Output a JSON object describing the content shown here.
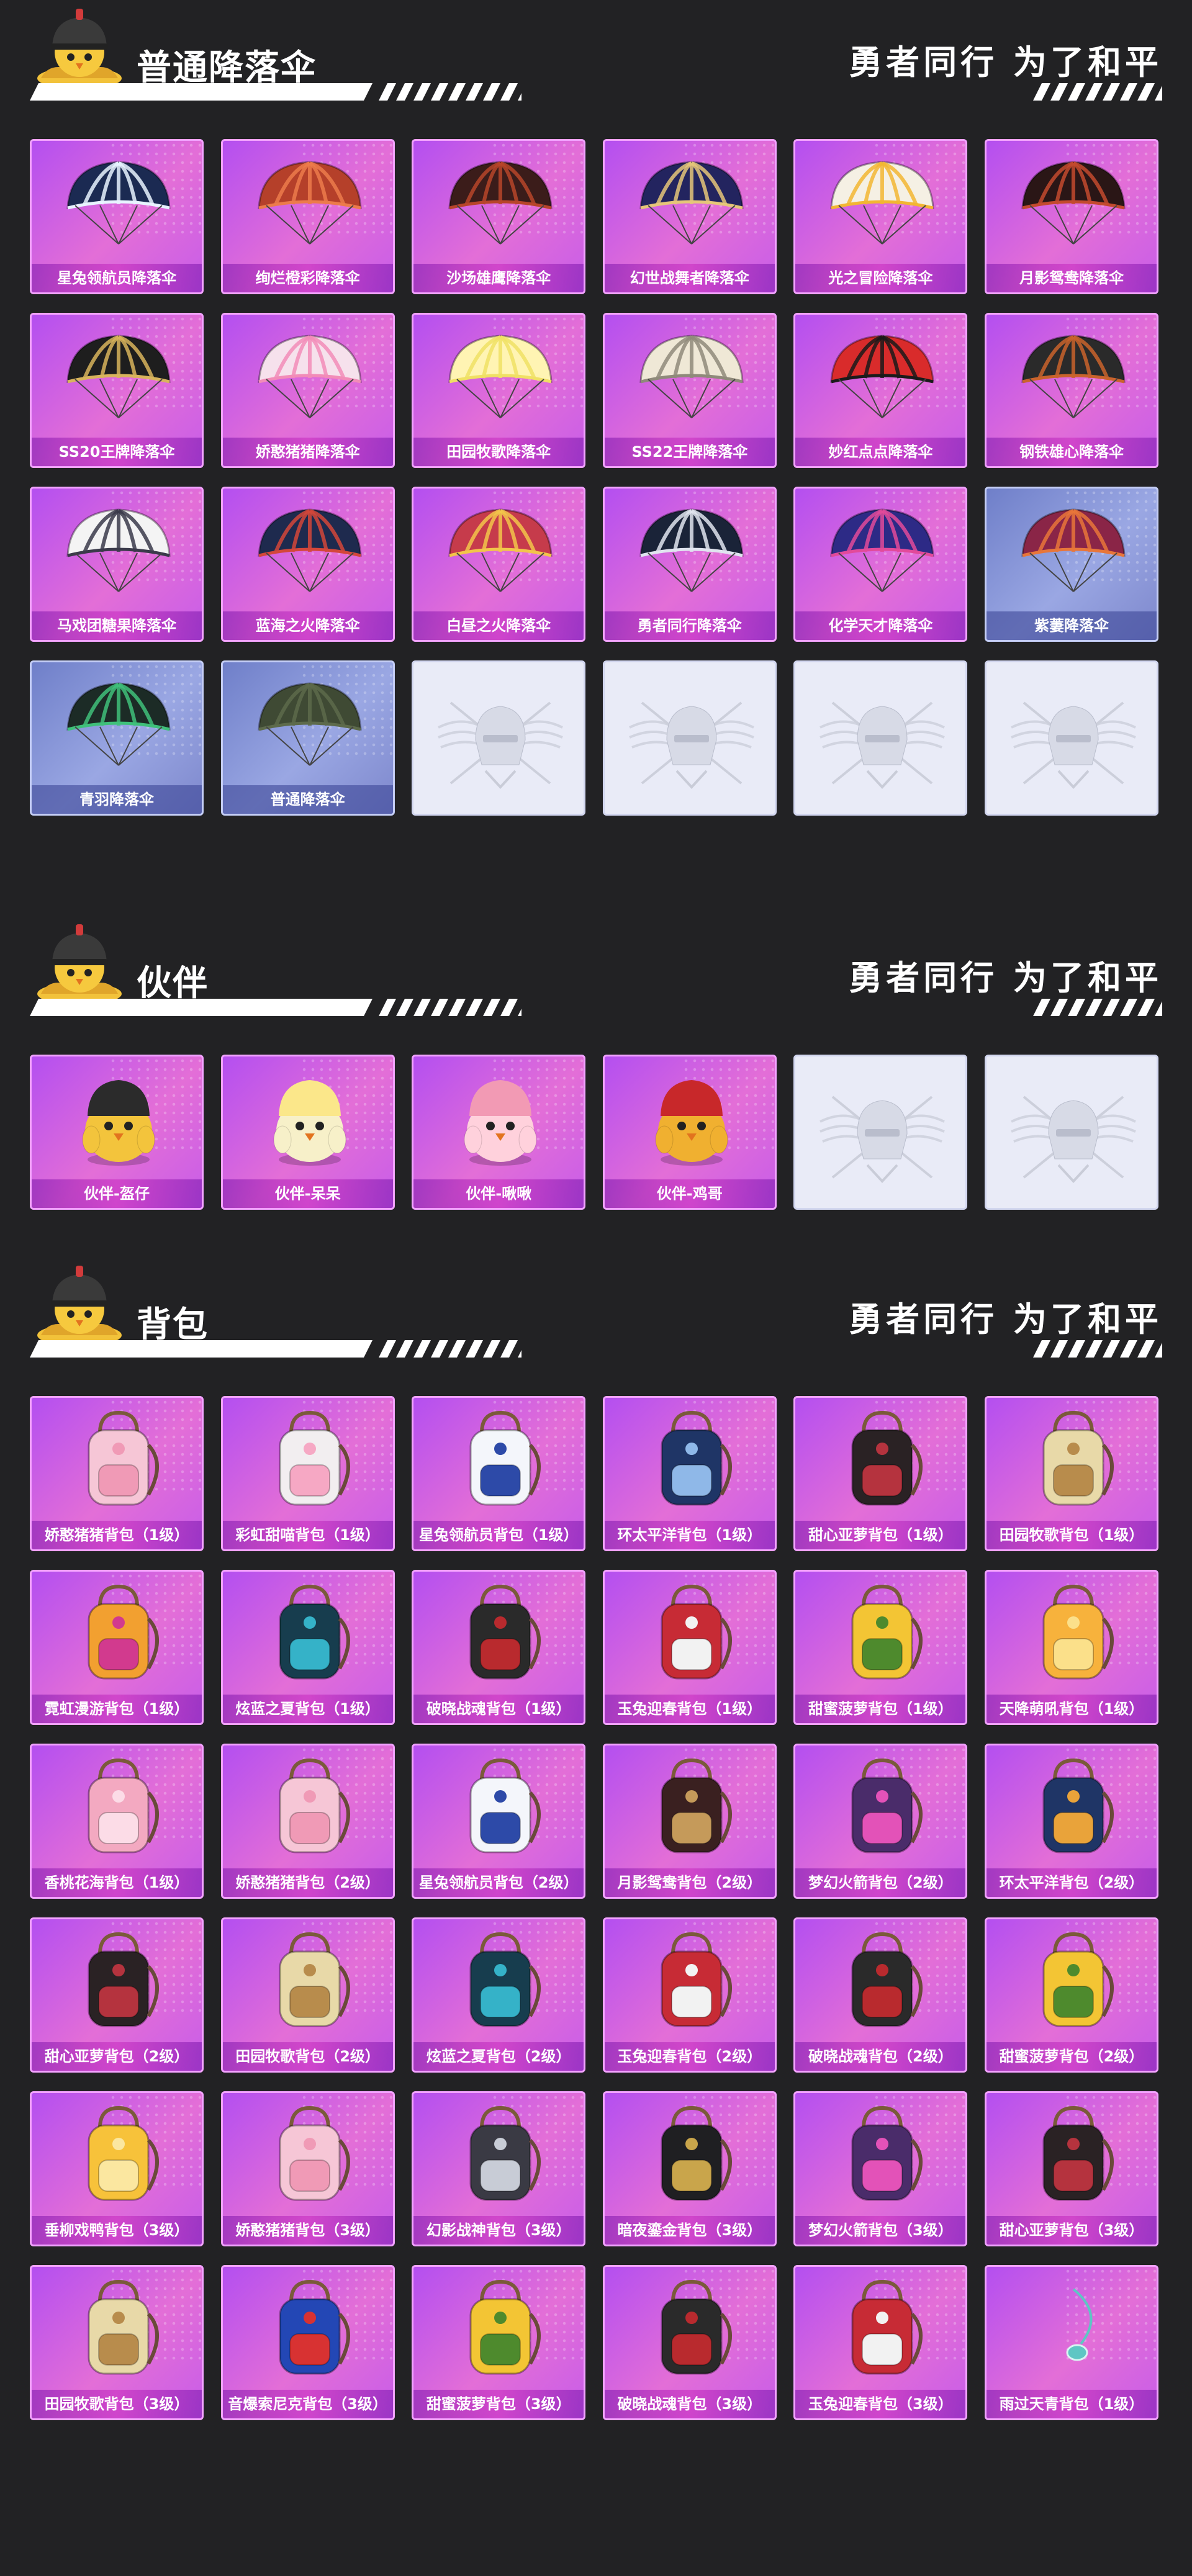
{
  "sections": [
    {
      "title": "普通降落伞",
      "slogan": "勇者同行 为了和平",
      "items": [
        {
          "label": "星兔领航员降落伞",
          "style": "purple",
          "icon": "parachute-icon",
          "colors": [
            "#1b2a52",
            "#e8f3ff"
          ]
        },
        {
          "label": "绚烂橙彩降落伞",
          "style": "purple",
          "icon": "parachute-icon",
          "colors": [
            "#b5402a",
            "#ec7b4b"
          ]
        },
        {
          "label": "沙场雄鹰降落伞",
          "style": "purple",
          "icon": "parachute-icon",
          "colors": [
            "#3b1c1a",
            "#b7452a"
          ]
        },
        {
          "label": "幻世战舞者降落伞",
          "style": "purple",
          "icon": "parachute-icon",
          "colors": [
            "#23245f",
            "#e5c679"
          ]
        },
        {
          "label": "光之冒险降落伞",
          "style": "purple",
          "icon": "parachute-icon",
          "colors": [
            "#f5f0e4",
            "#f2b632"
          ]
        },
        {
          "label": "月影鸳鸯降落伞",
          "style": "purple",
          "icon": "parachute-icon",
          "colors": [
            "#2a1616",
            "#c34a2e"
          ]
        },
        {
          "label": "SS20王牌降落伞",
          "style": "purple",
          "icon": "parachute-icon",
          "colors": [
            "#1e1e1e",
            "#d8b45c"
          ]
        },
        {
          "label": "娇憨猪猪降落伞",
          "style": "purple",
          "icon": "parachute-icon",
          "colors": [
            "#f6e1ec",
            "#f28cb8"
          ]
        },
        {
          "label": "田园牧歌降落伞",
          "style": "purple",
          "icon": "parachute-icon",
          "colors": [
            "#fff4b3",
            "#f0e064"
          ]
        },
        {
          "label": "SS22王牌降落伞",
          "style": "purple",
          "icon": "parachute-icon",
          "colors": [
            "#efe8d6",
            "#8f8a7a"
          ]
        },
        {
          "label": "妙红点点降落伞",
          "style": "purple",
          "icon": "parachute-icon",
          "colors": [
            "#d92b2b",
            "#1a1a1a"
          ]
        },
        {
          "label": "钢铁雄心降落伞",
          "style": "purple",
          "icon": "parachute-icon",
          "colors": [
            "#2a2a2a",
            "#c9632c"
          ]
        },
        {
          "label": "马戏团糖果降落伞",
          "style": "purple",
          "icon": "parachute-icon",
          "colors": [
            "#f4f4f4",
            "#3a3a4a"
          ]
        },
        {
          "label": "蓝海之火降落伞",
          "style": "purple",
          "icon": "parachute-icon",
          "colors": [
            "#1e2a4e",
            "#d3473a"
          ]
        },
        {
          "label": "白昼之火降落伞",
          "style": "purple",
          "icon": "parachute-icon",
          "colors": [
            "#c63b4b",
            "#f2c54a"
          ]
        },
        {
          "label": "勇者同行降落伞",
          "style": "purple",
          "icon": "parachute-icon",
          "colors": [
            "#1a2338",
            "#e0e4ef"
          ]
        },
        {
          "label": "化学天才降落伞",
          "style": "purple",
          "icon": "parachute-icon",
          "colors": [
            "#2d2a86",
            "#e24a9a"
          ]
        },
        {
          "label": "紫萋降落伞",
          "style": "blue",
          "icon": "parachute-icon",
          "colors": [
            "#8a2547",
            "#e8763a"
          ]
        },
        {
          "label": "青羽降落伞",
          "style": "blue",
          "icon": "parachute-icon",
          "colors": [
            "#1c2b26",
            "#3fc07a"
          ]
        },
        {
          "label": "普通降落伞",
          "style": "blue",
          "icon": "parachute-icon",
          "colors": [
            "#3f4a34",
            "#5d6a4b"
          ]
        },
        {
          "label": "",
          "style": "empty",
          "icon": "emblem-placeholder-icon"
        },
        {
          "label": "",
          "style": "empty",
          "icon": "emblem-placeholder-icon"
        },
        {
          "label": "",
          "style": "empty",
          "icon": "emblem-placeholder-icon"
        },
        {
          "label": "",
          "style": "empty",
          "icon": "emblem-placeholder-icon"
        }
      ]
    },
    {
      "title": "伙伴",
      "slogan": "勇者同行 为了和平",
      "items": [
        {
          "label": "伙伴-盔仔",
          "style": "purple",
          "icon": "chick-companion-icon",
          "colors": [
            "#2b2b2b",
            "#f3c43c"
          ]
        },
        {
          "label": "伙伴-呆呆",
          "style": "purple",
          "icon": "chick-companion-icon",
          "colors": [
            "#fbe78a",
            "#f7f0c9"
          ]
        },
        {
          "label": "伙伴-啾啾",
          "style": "purple",
          "icon": "chick-companion-icon",
          "colors": [
            "#f29ab4",
            "#ffd1dc"
          ]
        },
        {
          "label": "伙伴-鸡哥",
          "style": "purple",
          "icon": "chick-companion-icon",
          "colors": [
            "#c8282a",
            "#f0b030"
          ]
        },
        {
          "label": "",
          "style": "empty",
          "icon": "emblem-placeholder-icon"
        },
        {
          "label": "",
          "style": "empty",
          "icon": "emblem-placeholder-icon"
        }
      ]
    },
    {
      "title": "背包",
      "slogan": "勇者同行 为了和平",
      "items": [
        {
          "label": "娇憨猪猪背包（1级）",
          "style": "purple",
          "icon": "backpack-icon",
          "colors": [
            "#f6c6d6",
            "#f09ab6"
          ]
        },
        {
          "label": "彩虹甜喵背包（1级）",
          "style": "purple",
          "icon": "backpack-icon",
          "colors": [
            "#f2eef0",
            "#f6a8c4"
          ]
        },
        {
          "label": "星兔领航员背包（1级）",
          "style": "purple",
          "icon": "backpack-icon",
          "colors": [
            "#f4f6fb",
            "#2d4aa8"
          ]
        },
        {
          "label": "环太平洋背包（1级）",
          "style": "purple",
          "icon": "backpack-icon",
          "colors": [
            "#1f3566",
            "#8fb8e8"
          ]
        },
        {
          "label": "甜心亚萝背包（1级）",
          "style": "purple",
          "icon": "backpack-icon",
          "colors": [
            "#2a2224",
            "#b5333e"
          ]
        },
        {
          "label": "田园牧歌背包（1级）",
          "style": "purple",
          "icon": "backpack-icon",
          "colors": [
            "#e8d9a8",
            "#b88c4c"
          ]
        },
        {
          "label": "霓虹漫游背包（1级）",
          "style": "purple",
          "icon": "backpack-icon",
          "colors": [
            "#f2a030",
            "#d23a8e"
          ]
        },
        {
          "label": "炫蓝之夏背包（1级）",
          "style": "purple",
          "icon": "backpack-icon",
          "colors": [
            "#173d4e",
            "#35b2c8"
          ]
        },
        {
          "label": "破晓战魂背包（1级）",
          "style": "purple",
          "icon": "backpack-icon",
          "colors": [
            "#2a2a2a",
            "#b92a2e"
          ]
        },
        {
          "label": "玉兔迎春背包（1级）",
          "style": "purple",
          "icon": "backpack-icon",
          "colors": [
            "#c72b35",
            "#f2f2f2"
          ]
        },
        {
          "label": "甜蜜菠萝背包（1级）",
          "style": "purple",
          "icon": "backpack-icon",
          "colors": [
            "#f3c534",
            "#4e8a2d"
          ]
        },
        {
          "label": "天降萌吼背包（1级）",
          "style": "purple",
          "icon": "backpack-icon",
          "colors": [
            "#f7b23c",
            "#fbe08a"
          ]
        },
        {
          "label": "香桃花海背包（1级）",
          "style": "purple",
          "icon": "backpack-icon",
          "colors": [
            "#f3a9c1",
            "#fcdce7"
          ]
        },
        {
          "label": "娇憨猪猪背包（2级）",
          "style": "purple",
          "icon": "backpack-icon",
          "colors": [
            "#f6c6d6",
            "#f09ab6"
          ]
        },
        {
          "label": "星兔领航员背包（2级）",
          "style": "purple",
          "icon": "backpack-icon",
          "colors": [
            "#f4f6fb",
            "#2d4aa8"
          ]
        },
        {
          "label": "月影鸳鸯背包（2级）",
          "style": "purple",
          "icon": "backpack-icon",
          "colors": [
            "#3a2020",
            "#c59a5a"
          ]
        },
        {
          "label": "梦幻火箭背包（2级）",
          "style": "purple",
          "icon": "backpack-icon",
          "colors": [
            "#4a2c6a",
            "#e352b8"
          ]
        },
        {
          "label": "环太平洋背包（2级）",
          "style": "purple",
          "icon": "backpack-icon",
          "colors": [
            "#1f3566",
            "#e9a33a"
          ]
        },
        {
          "label": "甜心亚萝背包（2级）",
          "style": "purple",
          "icon": "backpack-icon",
          "colors": [
            "#2a2224",
            "#b5333e"
          ]
        },
        {
          "label": "田园牧歌背包（2级）",
          "style": "purple",
          "icon": "backpack-icon",
          "colors": [
            "#e8d9a8",
            "#b88c4c"
          ]
        },
        {
          "label": "炫蓝之夏背包（2级）",
          "style": "purple",
          "icon": "backpack-icon",
          "colors": [
            "#173d4e",
            "#35b2c8"
          ]
        },
        {
          "label": "玉兔迎春背包（2级）",
          "style": "purple",
          "icon": "backpack-icon",
          "colors": [
            "#c72b35",
            "#f2f2f2"
          ]
        },
        {
          "label": "破晓战魂背包（2级）",
          "style": "purple",
          "icon": "backpack-icon",
          "colors": [
            "#2a2a2a",
            "#b92a2e"
          ]
        },
        {
          "label": "甜蜜菠萝背包（2级）",
          "style": "purple",
          "icon": "backpack-icon",
          "colors": [
            "#f3c534",
            "#4e8a2d"
          ]
        },
        {
          "label": "垂柳戏鸭背包（3级）",
          "style": "purple",
          "icon": "backpack-icon",
          "colors": [
            "#f7c23a",
            "#fbe7a0"
          ]
        },
        {
          "label": "娇憨猪猪背包（3级）",
          "style": "purple",
          "icon": "backpack-icon",
          "colors": [
            "#f6c6d6",
            "#f09ab6"
          ]
        },
        {
          "label": "幻影战神背包（3级）",
          "style": "purple",
          "icon": "backpack-icon",
          "colors": [
            "#3a3a44",
            "#c8ccd6"
          ]
        },
        {
          "label": "暗夜鎏金背包（3级）",
          "style": "purple",
          "icon": "backpack-icon",
          "colors": [
            "#1f1f22",
            "#c9a54b"
          ]
        },
        {
          "label": "梦幻火箭背包（3级）",
          "style": "purple",
          "icon": "backpack-icon",
          "colors": [
            "#4a2c6a",
            "#e352b8"
          ]
        },
        {
          "label": "甜心亚萝背包（3级）",
          "style": "purple",
          "icon": "backpack-icon",
          "colors": [
            "#2a2224",
            "#b5333e"
          ]
        },
        {
          "label": "田园牧歌背包（3级）",
          "style": "purple",
          "icon": "backpack-icon",
          "colors": [
            "#e8d9a8",
            "#b88c4c"
          ]
        },
        {
          "label": "音爆索尼克背包（3级）",
          "style": "purple",
          "icon": "backpack-icon",
          "colors": [
            "#2347b5",
            "#d83232"
          ]
        },
        {
          "label": "甜蜜菠萝背包（3级）",
          "style": "purple",
          "icon": "backpack-icon",
          "colors": [
            "#f3c534",
            "#4e8a2d"
          ]
        },
        {
          "label": "破晓战魂背包（3级）",
          "style": "purple",
          "icon": "backpack-icon",
          "colors": [
            "#2a2a2a",
            "#b92a2e"
          ]
        },
        {
          "label": "玉兔迎春背包（3级）",
          "style": "purple",
          "icon": "backpack-icon",
          "colors": [
            "#c72b35",
            "#f2f2f2"
          ]
        },
        {
          "label": "雨过天青背包（1级）",
          "style": "purple",
          "icon": "pendant-icon",
          "colors": [
            "#5ec6c4",
            "#d9f4f2"
          ]
        }
      ]
    }
  ]
}
